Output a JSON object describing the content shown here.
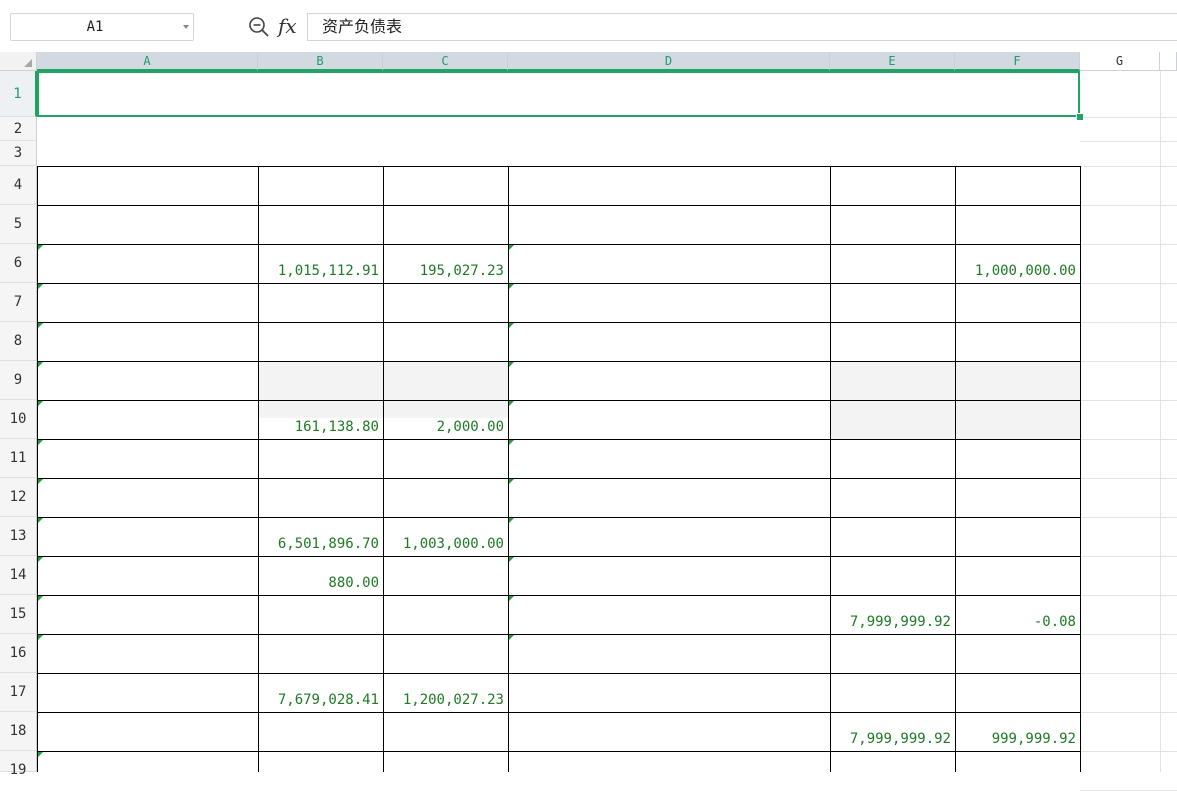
{
  "formula_bar": {
    "name_box": "A1",
    "fx_label": "fx",
    "formula": "资产负债表"
  },
  "columns": [
    "A",
    "B",
    "C",
    "D",
    "E",
    "F",
    "G"
  ],
  "rows": [
    "1",
    "2",
    "3",
    "4",
    "5",
    "6",
    "7",
    "8",
    "9",
    "10",
    "11",
    "12",
    "13",
    "14",
    "15",
    "16",
    "17",
    "18",
    "19"
  ],
  "cells": {
    "B6": "1,015,112.91",
    "C6": "195,027.23",
    "F6": "1,000,000.00",
    "B10": "161,138.80",
    "C10": "2,000.00",
    "B13": "6,501,896.70",
    "C13": "1,003,000.00",
    "B14": "880.00",
    "E15": "7,999,999.92",
    "F15": "-0.08",
    "B17": "7,679,028.41",
    "C17": "1,200,027.23",
    "E18": "7,999,999.92",
    "F18": "999,999.92"
  },
  "colors": {
    "selection": "#21a366",
    "number_text": "#1e7a25",
    "header_selected_bg": "#d3d9e0"
  }
}
